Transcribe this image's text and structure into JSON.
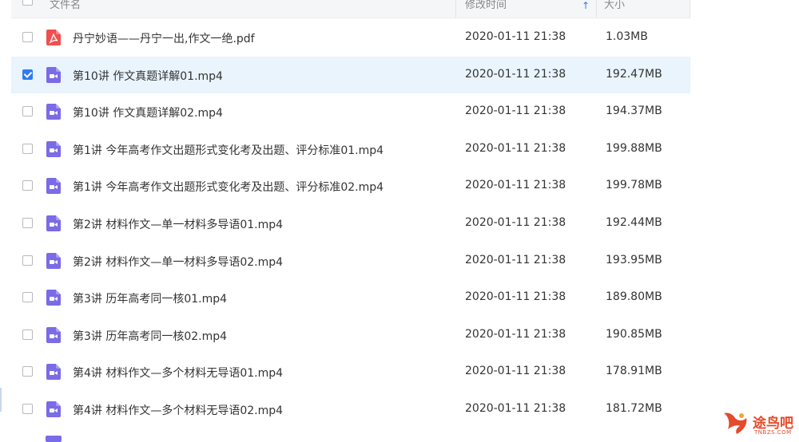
{
  "header": {
    "name_label": "文件名",
    "time_label": "修改时间",
    "size_label": "大小",
    "sort_arrow": "↑"
  },
  "colors": {
    "accent": "#2e7bf3",
    "video_icon": "#7a6be6",
    "pdf_icon": "#ef4f4f",
    "selected_row": "#e9f4fd",
    "watermark": "#e54a2a"
  },
  "files": [
    {
      "name": "丹宁妙语——丹宁一出,作文一绝.pdf",
      "time": "2020-01-11 21:38",
      "size": "1.03MB",
      "type": "pdf",
      "checked": false
    },
    {
      "name": "第10讲 作文真题详解01.mp4",
      "time": "2020-01-11 21:38",
      "size": "192.47MB",
      "type": "video",
      "checked": true
    },
    {
      "name": "第10讲 作文真题详解02.mp4",
      "time": "2020-01-11 21:38",
      "size": "194.37MB",
      "type": "video",
      "checked": false
    },
    {
      "name": "第1讲 今年高考作文出题形式变化考及出题、评分标准01.mp4",
      "time": "2020-01-11 21:38",
      "size": "199.88MB",
      "type": "video",
      "checked": false
    },
    {
      "name": "第1讲 今年高考作文出题形式变化考及出题、评分标准02.mp4",
      "time": "2020-01-11 21:38",
      "size": "199.78MB",
      "type": "video",
      "checked": false
    },
    {
      "name": "第2讲 材料作文—单一材料多导语01.mp4",
      "time": "2020-01-11 21:38",
      "size": "192.44MB",
      "type": "video",
      "checked": false
    },
    {
      "name": "第2讲 材料作文—单一材料多导语02.mp4",
      "time": "2020-01-11 21:38",
      "size": "193.95MB",
      "type": "video",
      "checked": false
    },
    {
      "name": "第3讲 历年高考同一核01.mp4",
      "time": "2020-01-11 21:38",
      "size": "189.80MB",
      "type": "video",
      "checked": false
    },
    {
      "name": "第3讲 历年高考同一核02.mp4",
      "time": "2020-01-11 21:38",
      "size": "190.85MB",
      "type": "video",
      "checked": false
    },
    {
      "name": "第4讲 材料作文—多个材料无导语01.mp4",
      "time": "2020-01-11 21:38",
      "size": "178.91MB",
      "type": "video",
      "checked": false
    },
    {
      "name": "第4讲 材料作文—多个材料无导语02.mp4",
      "time": "2020-01-11 21:38",
      "size": "181.72MB",
      "type": "video",
      "checked": false
    }
  ],
  "watermark": {
    "text": "途鸟吧",
    "sub": "TNBZS.COM",
    "icon": "bird-logo-icon"
  }
}
